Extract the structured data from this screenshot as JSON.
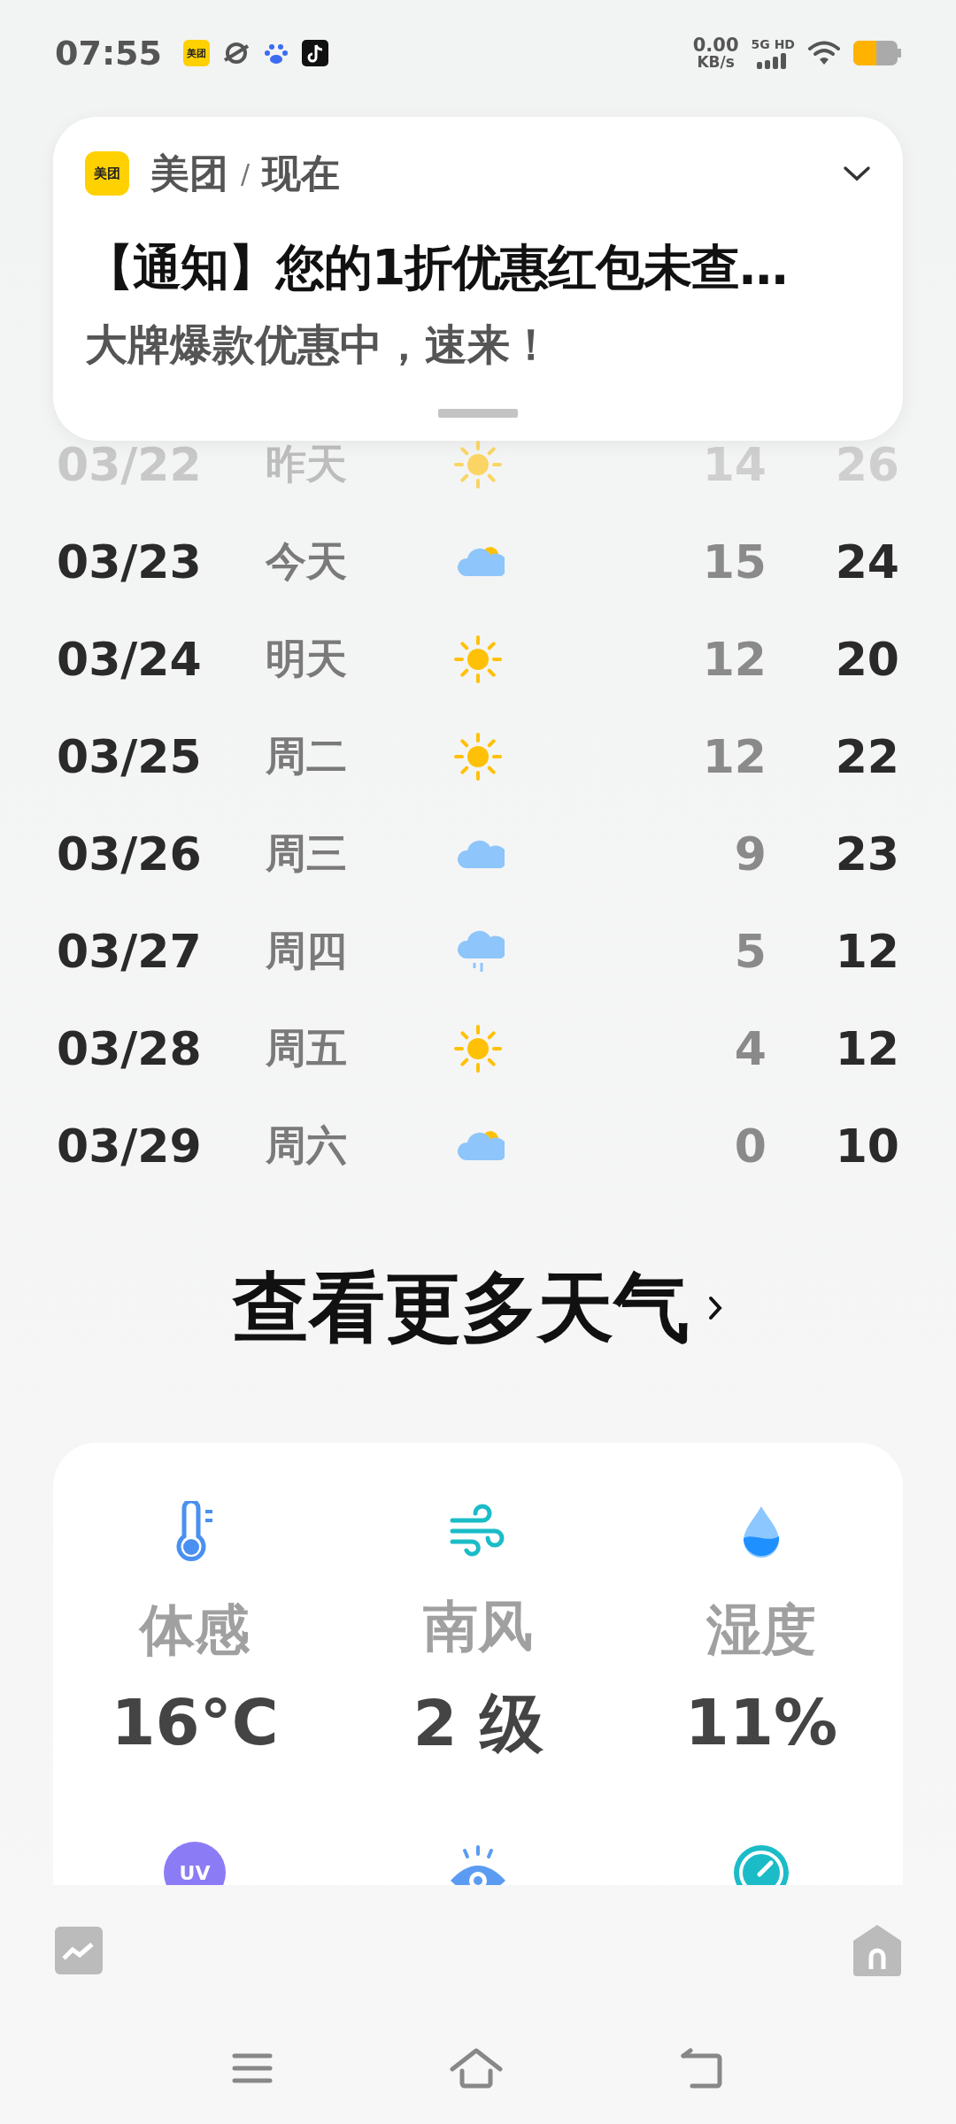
{
  "status_bar": {
    "time": "07:55",
    "app_icons": [
      {
        "kind": "meituan",
        "label": "美团"
      },
      {
        "kind": "planet"
      },
      {
        "kind": "paw"
      },
      {
        "kind": "note"
      }
    ],
    "speed": "0.00",
    "speed_unit": "KB/s",
    "network": "5G HD"
  },
  "notification": {
    "app_label": "美团",
    "app": "美团",
    "separator": "/",
    "time": "现在",
    "title": "【通知】您的1折优惠红包未查…",
    "body": "大牌爆款优惠中，速来！"
  },
  "forecast": [
    {
      "date": "03/22",
      "day": "昨天",
      "kind": "sunny",
      "low": "14",
      "high": "26",
      "dimmed": true
    },
    {
      "date": "03/23",
      "day": "今天",
      "kind": "partly_cloudy",
      "low": "15",
      "high": "24",
      "dimmed": false
    },
    {
      "date": "03/24",
      "day": "明天",
      "kind": "sunny",
      "low": "12",
      "high": "20",
      "dimmed": false
    },
    {
      "date": "03/25",
      "day": "周二",
      "kind": "sunny",
      "low": "12",
      "high": "22",
      "dimmed": false
    },
    {
      "date": "03/26",
      "day": "周三",
      "kind": "cloudy",
      "low": "9",
      "high": "23",
      "dimmed": false
    },
    {
      "date": "03/27",
      "day": "周四",
      "kind": "rain",
      "low": "5",
      "high": "12",
      "dimmed": false
    },
    {
      "date": "03/28",
      "day": "周五",
      "kind": "sunny",
      "low": "4",
      "high": "12",
      "dimmed": false
    },
    {
      "date": "03/29",
      "day": "周六",
      "kind": "partly_cloudy",
      "low": "0",
      "high": "10",
      "dimmed": false
    }
  ],
  "more_link": "查看更多天气",
  "details": [
    {
      "kind": "thermometer",
      "label": "体感",
      "value": "16°C"
    },
    {
      "kind": "wind",
      "label": "南风",
      "value": "2 级"
    },
    {
      "kind": "drop",
      "label": "湿度",
      "value": "11%"
    },
    {
      "kind": "uv",
      "icon_text": "UV"
    },
    {
      "kind": "eye"
    },
    {
      "kind": "gauge"
    }
  ],
  "bottom_bar": [
    {
      "kind": "chart"
    },
    {
      "kind": "house"
    }
  ],
  "nav_bar": [
    {
      "kind": "menu"
    },
    {
      "kind": "home"
    },
    {
      "kind": "back"
    }
  ]
}
